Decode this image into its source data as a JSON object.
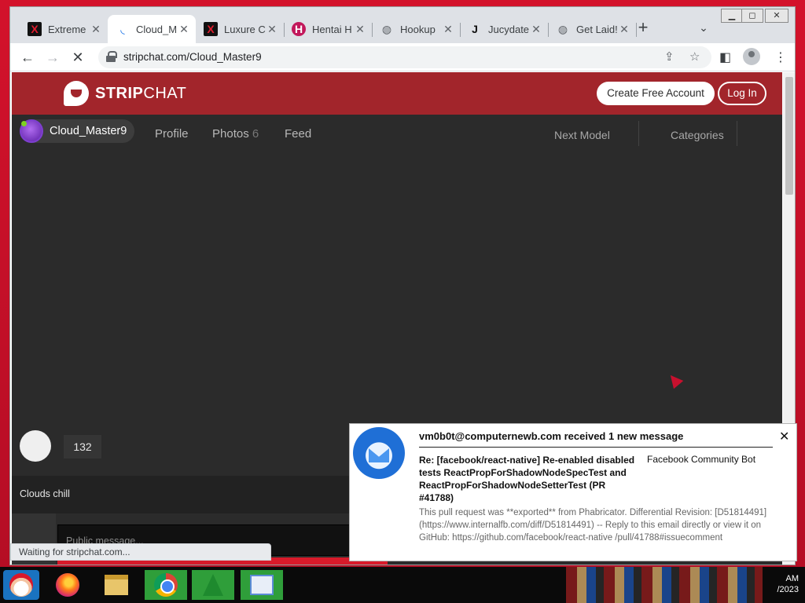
{
  "browser": {
    "tabs": [
      {
        "title": "Extreme",
        "icon": "x-logo-icon"
      },
      {
        "title": "Cloud_M",
        "icon": "loading-spinner-icon"
      },
      {
        "title": "Luxure C",
        "icon": "x-logo-icon"
      },
      {
        "title": "Hentai H",
        "icon": "hentaihaven-icon"
      },
      {
        "title": "Hookup",
        "icon": "globe-icon"
      },
      {
        "title": "Jucydate",
        "icon": "j-logo-icon"
      },
      {
        "title": "Get Laid!",
        "icon": "globe-icon"
      }
    ],
    "active_tab_index": 1,
    "url": "stripchat.com/Cloud_Master9",
    "status_text": "Waiting for stripchat.com..."
  },
  "site": {
    "logo_text_bold": "STRIP",
    "logo_text_thin": "CHAT",
    "create_account_label": "Create Free Account",
    "login_label": "Log In",
    "model_name": "Cloud_Master9",
    "nav": {
      "profile": "Profile",
      "photos": "Photos",
      "photos_count": "6",
      "feed": "Feed",
      "next_model": "Next Model",
      "categories": "Categories"
    },
    "viewer_count": "132",
    "room_subject": "Clouds chill",
    "message_placeholder": "Public message..."
  },
  "notification": {
    "title": "vm0b0t@computernewb.com received 1 new message",
    "subject": "Re: [facebook/react-native] Re-enabled disabled tests ReactPropForShadowNodeSpecTest and ReactPropForShadowNodeSetterTest (PR #41788)",
    "sender": "Facebook Community Bot",
    "body": "This pull request was **exported** from Phabricator. Differential Revision: [D51814491](https://www.internalfb.com/diff/D51814491) -- Reply to this email directly or view it on GitHub: https://github.com/facebook/react-native /pull/41788#issuecomment",
    "close_glyph": "✕"
  },
  "taskbar": {
    "clock_time": "AM",
    "clock_date": "/2023"
  },
  "colors": {
    "stripchat_red": "#a2252b",
    "page_bg": "#2b2b2b",
    "online": "#7ed321"
  }
}
